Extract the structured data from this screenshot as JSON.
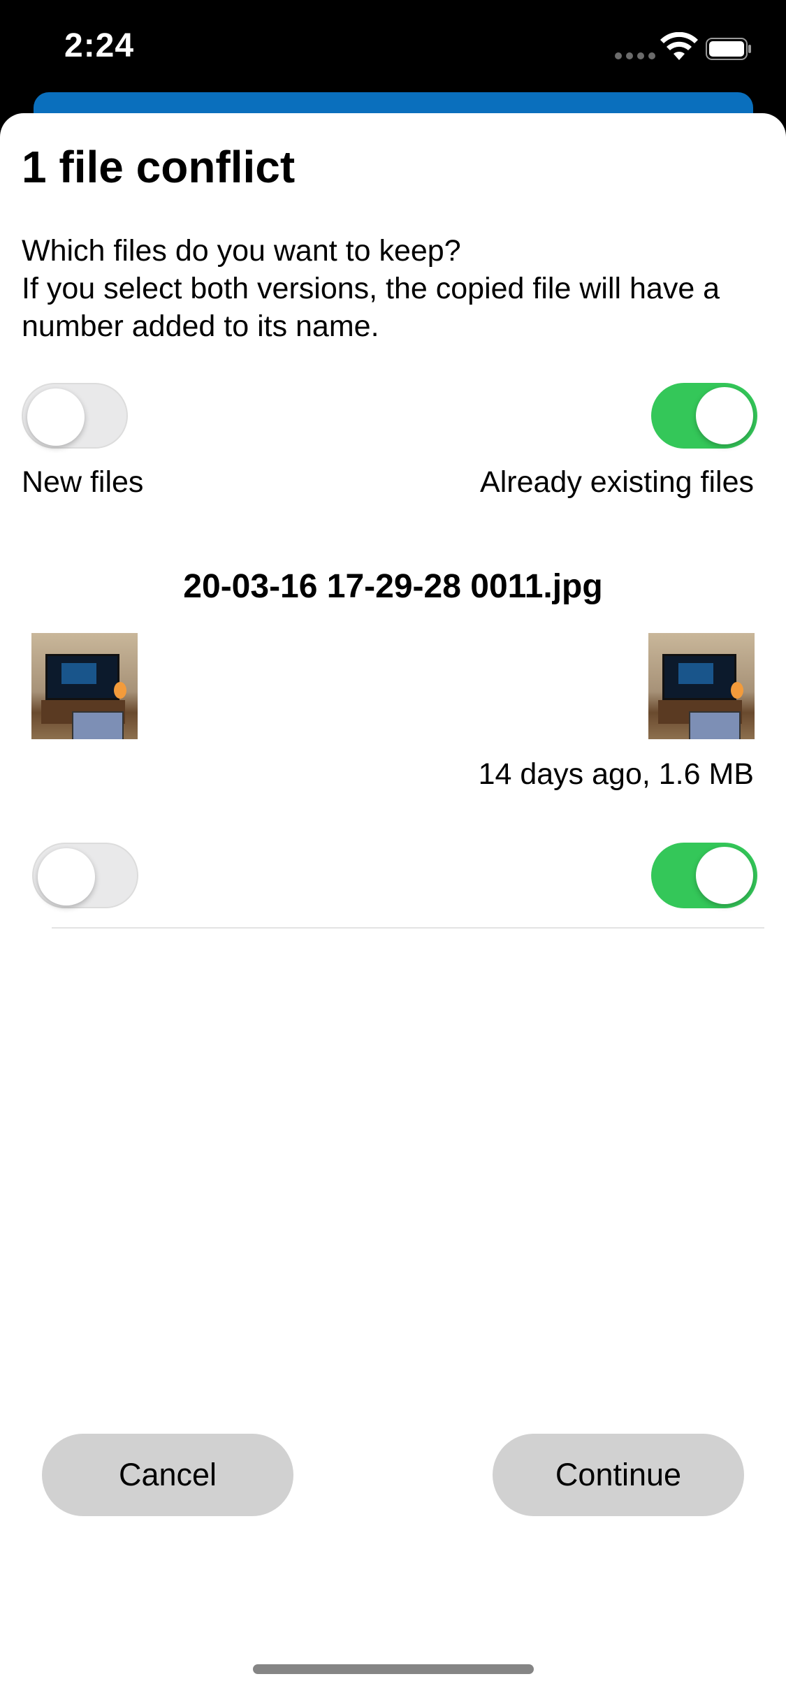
{
  "status_bar": {
    "time": "2:24",
    "icons": [
      "signal-dots-icon",
      "wifi-icon",
      "battery-icon"
    ]
  },
  "dialog": {
    "title": "1 file conflict",
    "description_line1": "Which files do you want to keep?",
    "description_line2": "If you select both versions, the copied file will have a number added to its name.",
    "new_files_label": "New files",
    "new_files_toggle_on": false,
    "existing_files_label": "Already existing files",
    "existing_files_toggle_on": true,
    "file": {
      "name": "20-03-16 17-29-28 0011.jpg",
      "existing_meta": "14 days ago, 1.6 MB",
      "new_toggle_on": false,
      "existing_toggle_on": true
    },
    "cancel_label": "Cancel",
    "continue_label": "Continue"
  },
  "colors": {
    "toggle_on": "#34c759",
    "toggle_off": "#e9e9ea",
    "button_bg": "#d1d1d1",
    "under_bar": "#0a6fbd"
  }
}
